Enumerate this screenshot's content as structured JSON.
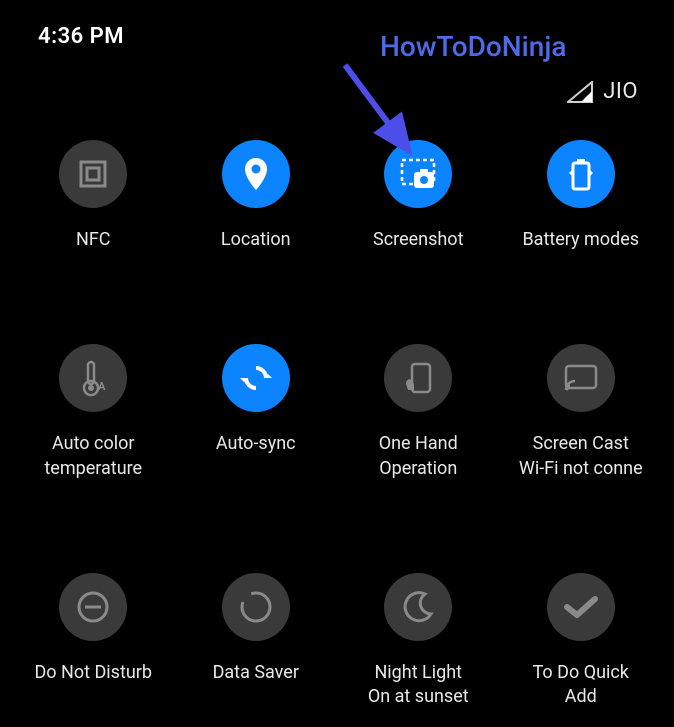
{
  "status": {
    "time": "4:36 PM",
    "network_label": "JIO"
  },
  "overlay": {
    "text": "HowToDoNinja"
  },
  "tiles": {
    "nfc": {
      "label": "NFC"
    },
    "location": {
      "label": "Location"
    },
    "screenshot": {
      "label": "Screenshot"
    },
    "battery": {
      "label": "Battery modes"
    },
    "autocolor": {
      "label": "Auto color\ntemperature"
    },
    "autosync": {
      "label": "Auto-sync"
    },
    "onehand": {
      "label": "One Hand\nOperation"
    },
    "screencast": {
      "label": "Screen Cast\nWi-Fi not conne"
    },
    "dnd": {
      "label": "Do Not Disturb"
    },
    "datasaver": {
      "label": "Data Saver"
    },
    "nightlight": {
      "label": "Night Light\nOn at sunset"
    },
    "todo": {
      "label": "To Do Quick\nAdd"
    }
  }
}
